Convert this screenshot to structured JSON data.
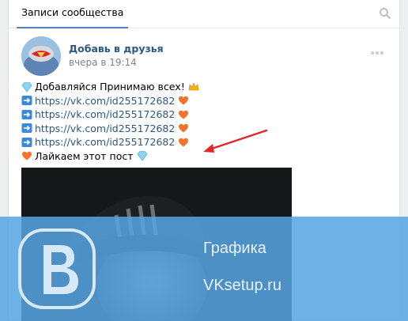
{
  "tabs": {
    "active_label": "Записи сообщества"
  },
  "post": {
    "author": "Добавь в друзья",
    "time": "вчера в 19:14",
    "lines": [
      {
        "prefix_icon": "diamond",
        "text": "Добавляйся Принимаю всех!",
        "suffix_icon": "crown"
      },
      {
        "prefix_icon": "right-arrow",
        "text": "https://vk.com/id255172682",
        "suffix_icon": "orange-heart"
      },
      {
        "prefix_icon": "right-arrow",
        "text": "https://vk.com/id255172682",
        "suffix_icon": "orange-heart"
      },
      {
        "prefix_icon": "right-arrow",
        "text": "https://vk.com/id255172682",
        "suffix_icon": "orange-heart"
      },
      {
        "prefix_icon": "right-arrow",
        "text": "https://vk.com/id255172682",
        "suffix_icon": "orange-heart"
      },
      {
        "prefix_icon": "orange-heart",
        "text": "Лайкаем этот пост",
        "suffix_icon": "diamond"
      }
    ]
  },
  "watermark": {
    "title": "Графика",
    "site": "VKsetup.ru"
  },
  "colors": {
    "link": "#2a5885",
    "tab_underline": "#5181b8",
    "annotation_arrow": "#e0282c",
    "watermark_overlay": "#56a4e2"
  }
}
